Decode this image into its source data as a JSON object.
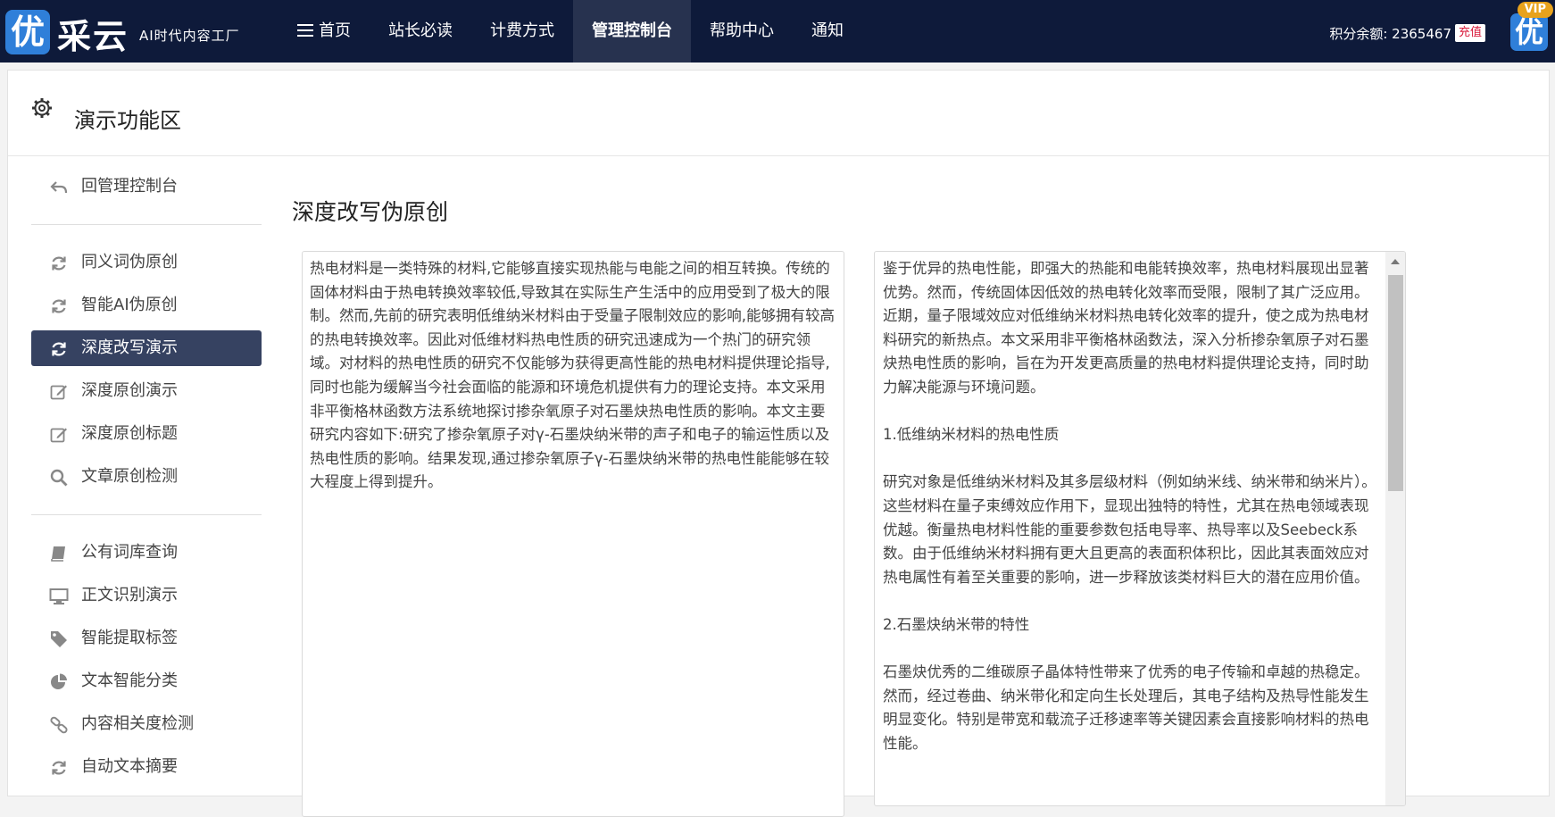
{
  "header": {
    "logo_mark": "优",
    "logo_text": "采云",
    "slogan": "AI时代内容工厂",
    "nav": [
      {
        "label": "首页"
      },
      {
        "label": "站长必读"
      },
      {
        "label": "计费方式"
      },
      {
        "label": "管理控制台"
      },
      {
        "label": "帮助中心"
      },
      {
        "label": "通知"
      }
    ],
    "credits_label": "积分余额: 2365467",
    "recharge_label": "充值",
    "avatar_mark": "优",
    "vip_label": "VIP"
  },
  "panel": {
    "title": "演示功能区"
  },
  "sidebar": {
    "items": [
      {
        "label": "回管理控制台",
        "icon": "back-arrow-icon"
      },
      {
        "label": "同义词伪原创",
        "icon": "refresh-icon"
      },
      {
        "label": "智能AI伪原创",
        "icon": "refresh-icon"
      },
      {
        "label": "深度改写演示",
        "icon": "refresh-icon",
        "active": true
      },
      {
        "label": "深度原创演示",
        "icon": "edit-icon"
      },
      {
        "label": "深度原创标题",
        "icon": "edit-icon"
      },
      {
        "label": "文章原创检测",
        "icon": "search-icon"
      },
      {
        "label": "公有词库查询",
        "icon": "book-icon"
      },
      {
        "label": "正文识别演示",
        "icon": "monitor-icon"
      },
      {
        "label": "智能提取标签",
        "icon": "tag-icon"
      },
      {
        "label": "文本智能分类",
        "icon": "pie-chart-icon"
      },
      {
        "label": "内容相关度检测",
        "icon": "link-icon"
      },
      {
        "label": "自动文本摘要",
        "icon": "refresh-icon"
      }
    ]
  },
  "main": {
    "title": "深度改写伪原创",
    "input_text": "热电材料是一类特殊的材料,它能够直接实现热能与电能之间的相互转换。传统的固体材料由于热电转换效率较低,导致其在实际生产生活中的应用受到了极大的限制。然而,先前的研究表明低维纳米材料由于受量子限制效应的影响,能够拥有较高的热电转换效率。因此对低维材料热电性质的研究迅速成为一个热门的研究领域。对材料的热电性质的研究不仅能够为获得更高性能的热电材料提供理论指导,同时也能为缓解当今社会面临的能源和环境危机提供有力的理论支持。本文采用非平衡格林函数方法系统地探讨掺杂氧原子对石墨炔热电性质的影响。本文主要研究内容如下:研究了掺杂氧原子对γ-石墨炔纳米带的声子和电子的输运性质以及热电性质的影响。结果发现,通过掺杂氧原子γ-石墨炔纳米带的热电性能能够在较大程度上得到提升。",
    "output_paragraphs": [
      "鉴于优异的热电性能，即强大的热能和电能转换效率，热电材料展现出显著优势。然而，传统固体因低效的热电转化效率而受限，限制了其广泛应用。近期，量子限域效应对低维纳米材料热电转化效率的提升，使之成为热电材料研究的新热点。本文采用非平衡格林函数法，深入分析掺杂氧原子对石墨炔热电性质的影响，旨在为开发更高质量的热电材料提供理论支持，同时助力解决能源与环境问题。",
      "1.低维纳米材料的热电性质",
      "研究对象是低维纳米材料及其多层级材料（例如纳米线、纳米带和纳米片）。这些材料在量子束缚效应作用下，显现出独特的特性，尤其在热电领域表现优越。衡量热电材料性能的重要参数包括电导率、热导率以及Seebeck系数。由于低维纳米材料拥有更大且更高的表面积体积比，因此其表面效应对热电属性有着至关重要的影响，进一步释放该类材料巨大的潜在应用价值。",
      "2.石墨炔纳米带的特性",
      "石墨炔优秀的二维碳原子晶体特性带来了优秀的电子传输和卓越的热稳定。然而，经过卷曲、纳米带化和定向生长处理后，其电子结构及热导性能发生明显变化。特别是带宽和载流子迁移速率等关键因素会直接影响材料的热电性能。"
    ]
  },
  "colors": {
    "topbar": "#0e1a3a",
    "nav_active": "#27324f",
    "sidebar_active": "#364261",
    "logo_blue": "#2f7fd9",
    "recharge_red": "#d81b3c",
    "vip_gold": "#e8a21c"
  }
}
